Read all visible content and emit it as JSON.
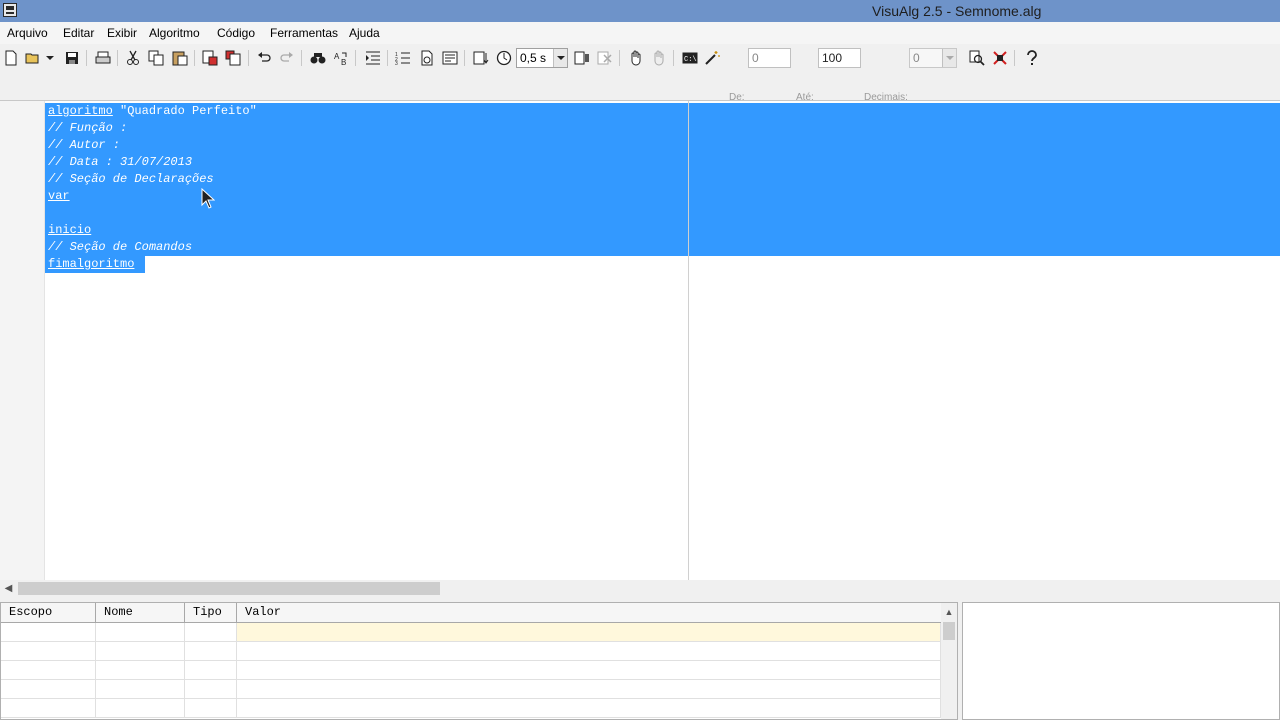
{
  "window": {
    "title": "VisuAlg 2.5 - Semnome.alg"
  },
  "menu": {
    "items": [
      "Arquivo",
      "Editar",
      "Exibir",
      "Algoritmo",
      "Código",
      "Ferramentas",
      "Ajuda"
    ]
  },
  "toolbar": {
    "speed_value": "0,5 s",
    "de_label": "De:",
    "de_value": "0",
    "ate_label": "Até:",
    "ate_value": "100",
    "decimais_label": "Decimais:",
    "decimais_value": "0"
  },
  "editor": {
    "lines": [
      {
        "kw": "algoritmo",
        "rest": " \"Quadrado Perfeito\""
      },
      {
        "comment": "// Função :"
      },
      {
        "comment": "// Autor :"
      },
      {
        "comment": "// Data : 31/07/2013"
      },
      {
        "comment": "// Seção de Declarações"
      },
      {
        "kw": "var"
      },
      {
        "blank": ""
      },
      {
        "kw": "inicio"
      },
      {
        "comment": "// Seção de Comandos"
      },
      {
        "kw": "fimalgoritmo"
      }
    ],
    "selection_color": "#3399ff"
  },
  "variables": {
    "columns": [
      "Escopo",
      "Nome",
      "Tipo",
      "Valor"
    ]
  },
  "colors": {
    "titlebar": "#6e93c9",
    "selection": "#3399ff",
    "current_row": "#fff8dc"
  },
  "icons": [
    "new-file-icon",
    "open-folder-icon",
    "save-icon",
    "print-icon",
    "cut-icon",
    "copy-icon",
    "paste-icon",
    "export-icon",
    "import-icon",
    "undo-icon",
    "redo-icon",
    "find-icon",
    "replace-icon",
    "indent-icon",
    "numbering-icon",
    "document-icon",
    "format-icon",
    "step-icon",
    "timer-icon",
    "watch-icon",
    "stop-icon",
    "hand-icon",
    "hand-off-icon",
    "console-icon",
    "magic-wand-icon",
    "zoom-icon",
    "debug-icon",
    "help-icon"
  ]
}
